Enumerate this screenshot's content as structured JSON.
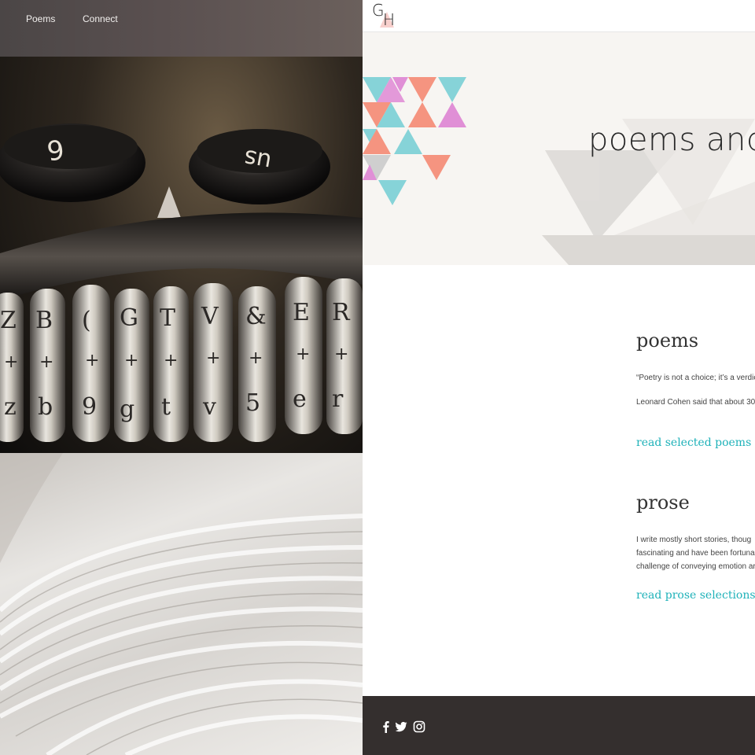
{
  "nav": {
    "poems_label": "Poems",
    "connect_label": "Connect"
  },
  "brand": {
    "logo_g": "G",
    "logo_h": "H"
  },
  "hero": {
    "title": "poems and"
  },
  "sections": {
    "poems": {
      "title": "poems",
      "text_1": "“Poetry is not a choice; it’s a verdic",
      "text_2": "Leonard Cohen said that about 30",
      "link": "read selected poems"
    },
    "prose": {
      "title": "prose",
      "line_1": "I write mostly short stories, thoug",
      "line_2": "fascinating and have been fortuna",
      "line_3": "challenge of conveying emotion ar",
      "link": "read prose selections"
    }
  },
  "footer": {
    "icons": [
      "facebook-icon",
      "twitter-icon",
      "instagram-icon"
    ]
  },
  "colors": {
    "accent_teal": "#1fb2b9",
    "triangle_cyan": "#86d3d8",
    "triangle_salmon": "#f59480",
    "triangle_pink": "#e08fd6",
    "triangle_grey": "#cfcfcf",
    "footer_bg": "#342f2e"
  }
}
